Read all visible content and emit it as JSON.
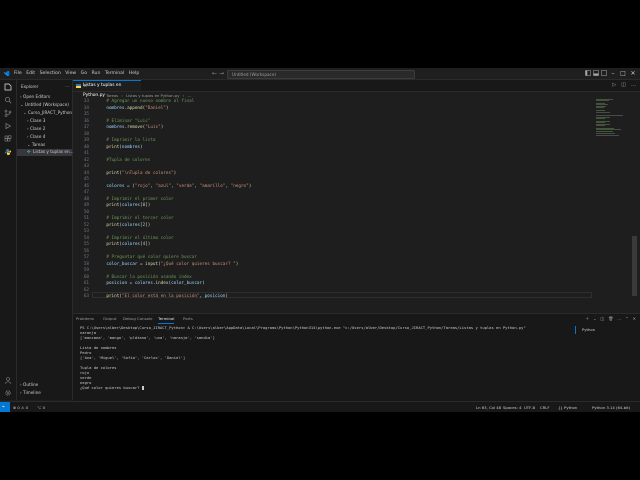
{
  "menu": [
    "File",
    "Edit",
    "Selection",
    "View",
    "Go",
    "Run",
    "Terminal",
    "Help"
  ],
  "search": {
    "placeholder": "Untitled (Workspace)"
  },
  "sidebar": {
    "title": "Explorer",
    "open_editors": "Open Editors",
    "workspace": "Untitled (Workspace)",
    "folder": "Curso_JIRACT_Python",
    "items": [
      "Clase 3",
      "Clase 2",
      "Clase 4",
      "Tareas",
      "Listas y tuplas en..."
    ],
    "outline": "Outline",
    "timeline": "Timeline"
  },
  "tab": {
    "label": "Listas y tuplas en Python.py"
  },
  "breadcrumb": [
    "Tareas",
    "Listas y tuplas en Python.py",
    "..."
  ],
  "code_lines": [
    {
      "n": "33",
      "t": "    # Agregar un nuevo nombre al final",
      "c": "cmt"
    },
    {
      "n": "34",
      "t": "    nombres.append(\"Daniel\")",
      "c": "code"
    },
    {
      "n": "35",
      "t": "",
      "c": "code"
    },
    {
      "n": "36",
      "t": "    # Eliminar \"Luis\"",
      "c": "cmt"
    },
    {
      "n": "37",
      "t": "    nombres.remove(\"Luis\")",
      "c": "code"
    },
    {
      "n": "38",
      "t": "",
      "c": "code"
    },
    {
      "n": "39",
      "t": "    # Imprimir la lista",
      "c": "cmt"
    },
    {
      "n": "40",
      "t": "    print(nombres)",
      "c": "code"
    },
    {
      "n": "41",
      "t": "",
      "c": "code"
    },
    {
      "n": "42",
      "t": "    #Tupla de colores",
      "c": "cmt"
    },
    {
      "n": "43",
      "t": "",
      "c": "code"
    },
    {
      "n": "44",
      "t": "    print(\"\\nTupla de colores\")",
      "c": "code"
    },
    {
      "n": "45",
      "t": "",
      "c": "code"
    },
    {
      "n": "46",
      "t": "    colores = (\"rojo\", \"azul\", \"verde\", \"amarillo\", \"negro\")",
      "c": "code"
    },
    {
      "n": "47",
      "t": "",
      "c": "code"
    },
    {
      "n": "48",
      "t": "    # Imprimir el primer color",
      "c": "cmt"
    },
    {
      "n": "49",
      "t": "    print(colores[0])",
      "c": "code"
    },
    {
      "n": "50",
      "t": "",
      "c": "code"
    },
    {
      "n": "51",
      "t": "    # Imprimir el tercer color",
      "c": "cmt"
    },
    {
      "n": "52",
      "t": "    print(colores[2])",
      "c": "code"
    },
    {
      "n": "53",
      "t": "",
      "c": "code"
    },
    {
      "n": "54",
      "t": "    # Imprimir el último color",
      "c": "cmt"
    },
    {
      "n": "55",
      "t": "    print(colores[4])",
      "c": "code"
    },
    {
      "n": "56",
      "t": "",
      "c": "code"
    },
    {
      "n": "57",
      "t": "    # Preguntar qué color quiere buscar",
      "c": "cmt"
    },
    {
      "n": "58",
      "t": "    color_buscar = input(\"¿Qué color quieres buscar? \")",
      "c": "code"
    },
    {
      "n": "59",
      "t": "",
      "c": "code"
    },
    {
      "n": "60",
      "t": "    # Buscar la posición usando index",
      "c": "cmt"
    },
    {
      "n": "61",
      "t": "    posicion = colores.index(color_buscar)",
      "c": "code"
    },
    {
      "n": "62",
      "t": "",
      "c": "code"
    },
    {
      "n": "63",
      "t": "    print(\"El color está en la posición\", posicion)",
      "c": "code"
    }
  ],
  "panel": {
    "tabs": [
      "Problems",
      "Output",
      "Debug Console",
      "Terminal",
      "Ports"
    ],
    "active": "Terminal",
    "side_label": "Python",
    "lines": [
      "PS C:\\Users\\alber\\Desktop\\Curso_JIRACT_Python> & C:\\Users\\alber\\AppData\\Local\\Programs\\Python\\Python314\\python.exe \"c:/Users/alber/Desktop/Curso_JIRACT_Python/Tareas/Listas y tuplas en Python.py\"",
      "naranja",
      "['manzana', 'mango', 'plátano', 'uva', 'naranja', 'sandia']",
      "",
      "Lista de nombres",
      "Pedro",
      "['Ana', 'Miguel', 'Sofía', 'Carlos', 'Daniel']",
      "",
      "Tupla de colores",
      "rojo",
      "verde",
      "negro",
      "¿Qué color quieres buscar? "
    ]
  },
  "status": {
    "left": [
      "⊗ 0 ⚠ 0",
      "⌥ 0"
    ],
    "right": [
      "Ln 63, Col 48",
      "Spaces: 4",
      "UTF-8",
      "CRLF",
      "{} Python",
      "Python 3.14 (64-bit)"
    ]
  },
  "colors": {
    "accent": "#0078d4",
    "bg": "#1e1e1e",
    "sidebar": "#181818"
  }
}
